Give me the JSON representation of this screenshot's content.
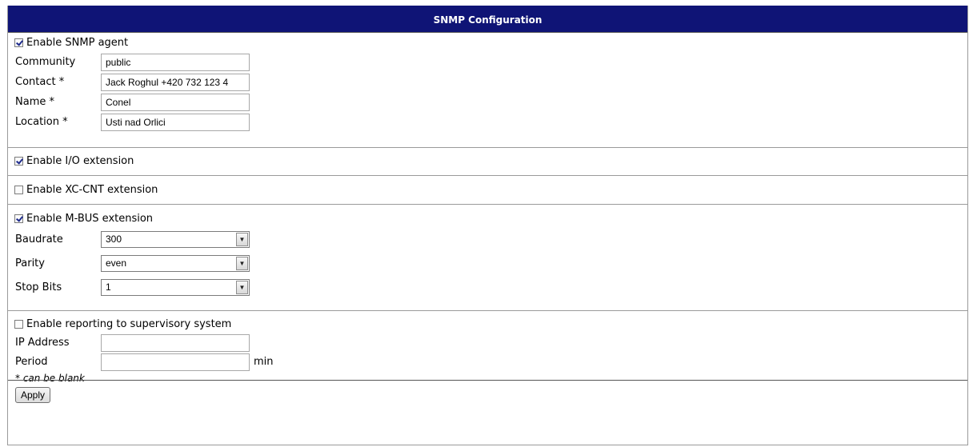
{
  "title": "SNMP Configuration",
  "snmp": {
    "enable_label": "Enable SNMP agent",
    "enabled": true,
    "community_label": "Community",
    "community_value": "public",
    "contact_label": "Contact *",
    "contact_value": "Jack Roghul +420 732 123 4",
    "name_label": "Name *",
    "name_value": "Conel",
    "location_label": "Location *",
    "location_value": "Usti nad Orlici"
  },
  "io": {
    "enable_label": "Enable I/O extension",
    "enabled": true
  },
  "xccnt": {
    "enable_label": "Enable XC-CNT extension",
    "enabled": false
  },
  "mbus": {
    "enable_label": "Enable M-BUS extension",
    "enabled": true,
    "baudrate_label": "Baudrate",
    "baudrate_value": "300",
    "parity_label": "Parity",
    "parity_value": "even",
    "stopbits_label": "Stop Bits",
    "stopbits_value": "1"
  },
  "reporting": {
    "enable_label": "Enable reporting to supervisory system",
    "enabled": false,
    "ip_label": "IP Address",
    "ip_value": "",
    "period_label": "Period",
    "period_value": "",
    "period_unit": "min",
    "note": "* can be blank"
  },
  "apply_label": "Apply"
}
